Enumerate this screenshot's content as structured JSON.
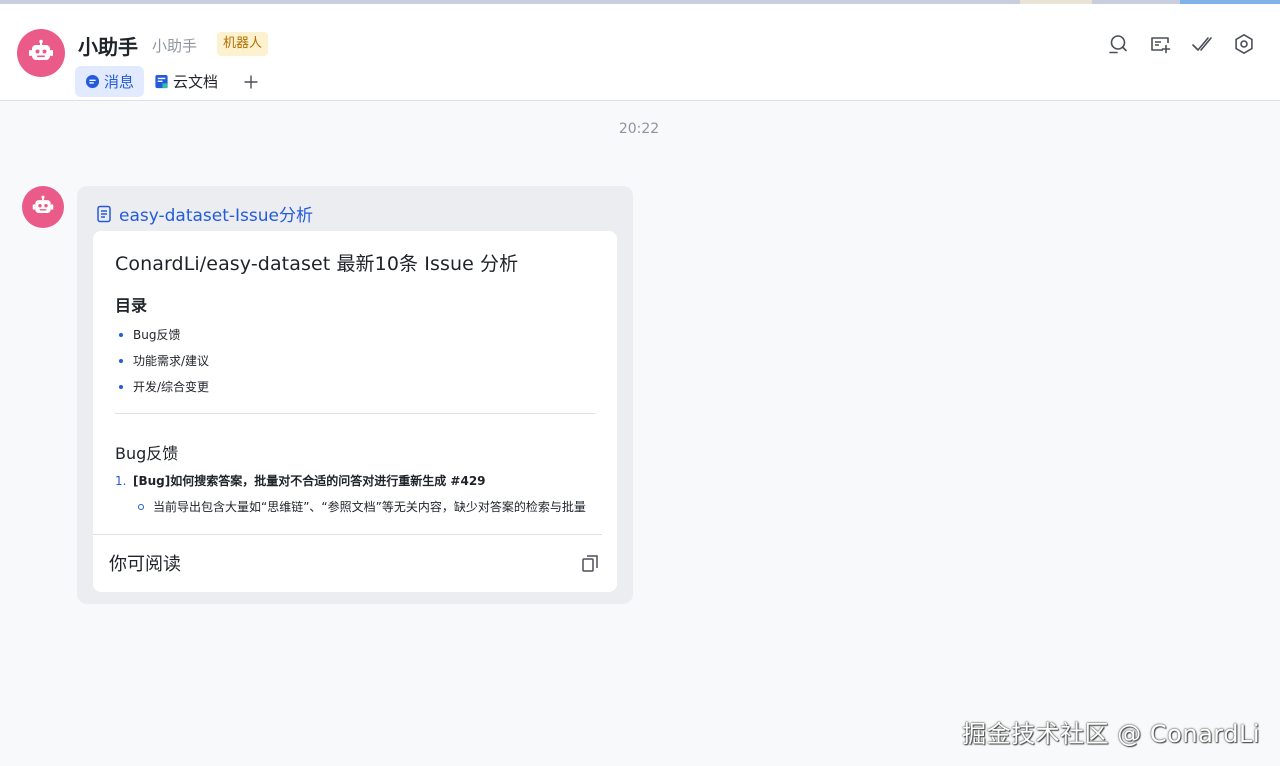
{
  "chat": {
    "title": "小助手",
    "subtitle": "小助手",
    "badge": "机器人"
  },
  "tabs": [
    {
      "label": "消息",
      "icon": "message-icon",
      "active": true
    },
    {
      "label": "云文档",
      "icon": "doc-icon",
      "active": false
    }
  ],
  "tab_add_label": "+",
  "header_actions": [
    "search-icon",
    "add-to-group-icon",
    "done-check-icon",
    "settings-icon"
  ],
  "messages": {
    "timestamp": "20:22",
    "doc_link_title": "easy-dataset-Issue分析",
    "preview": {
      "title": "ConardLi/easy-dataset 最新10条 Issue 分析",
      "toc_heading": "目录",
      "toc_items": [
        "Bug反馈",
        "功能需求/建议",
        "开发/综合变更"
      ],
      "section_heading": "Bug反馈",
      "issue_number": "1.",
      "issue_title": "[Bug]如何搜索答案，批量对不合适的问答对进行重新生成 #429",
      "issue_detail": "当前导出包含大量如“思维链”、“参照文档”等无关内容，缺少对答案的检索与批量优化能力，建议增强答案搜索与批量操作"
    },
    "footer_label": "你可阅读"
  },
  "watermark": "掘金技术社区 @ ConardLi",
  "colors": {
    "accent": "#245bdb",
    "avatar": "#ea5b8a",
    "badge_bg": "#fdf2d0",
    "badge_text": "#b36f00"
  }
}
